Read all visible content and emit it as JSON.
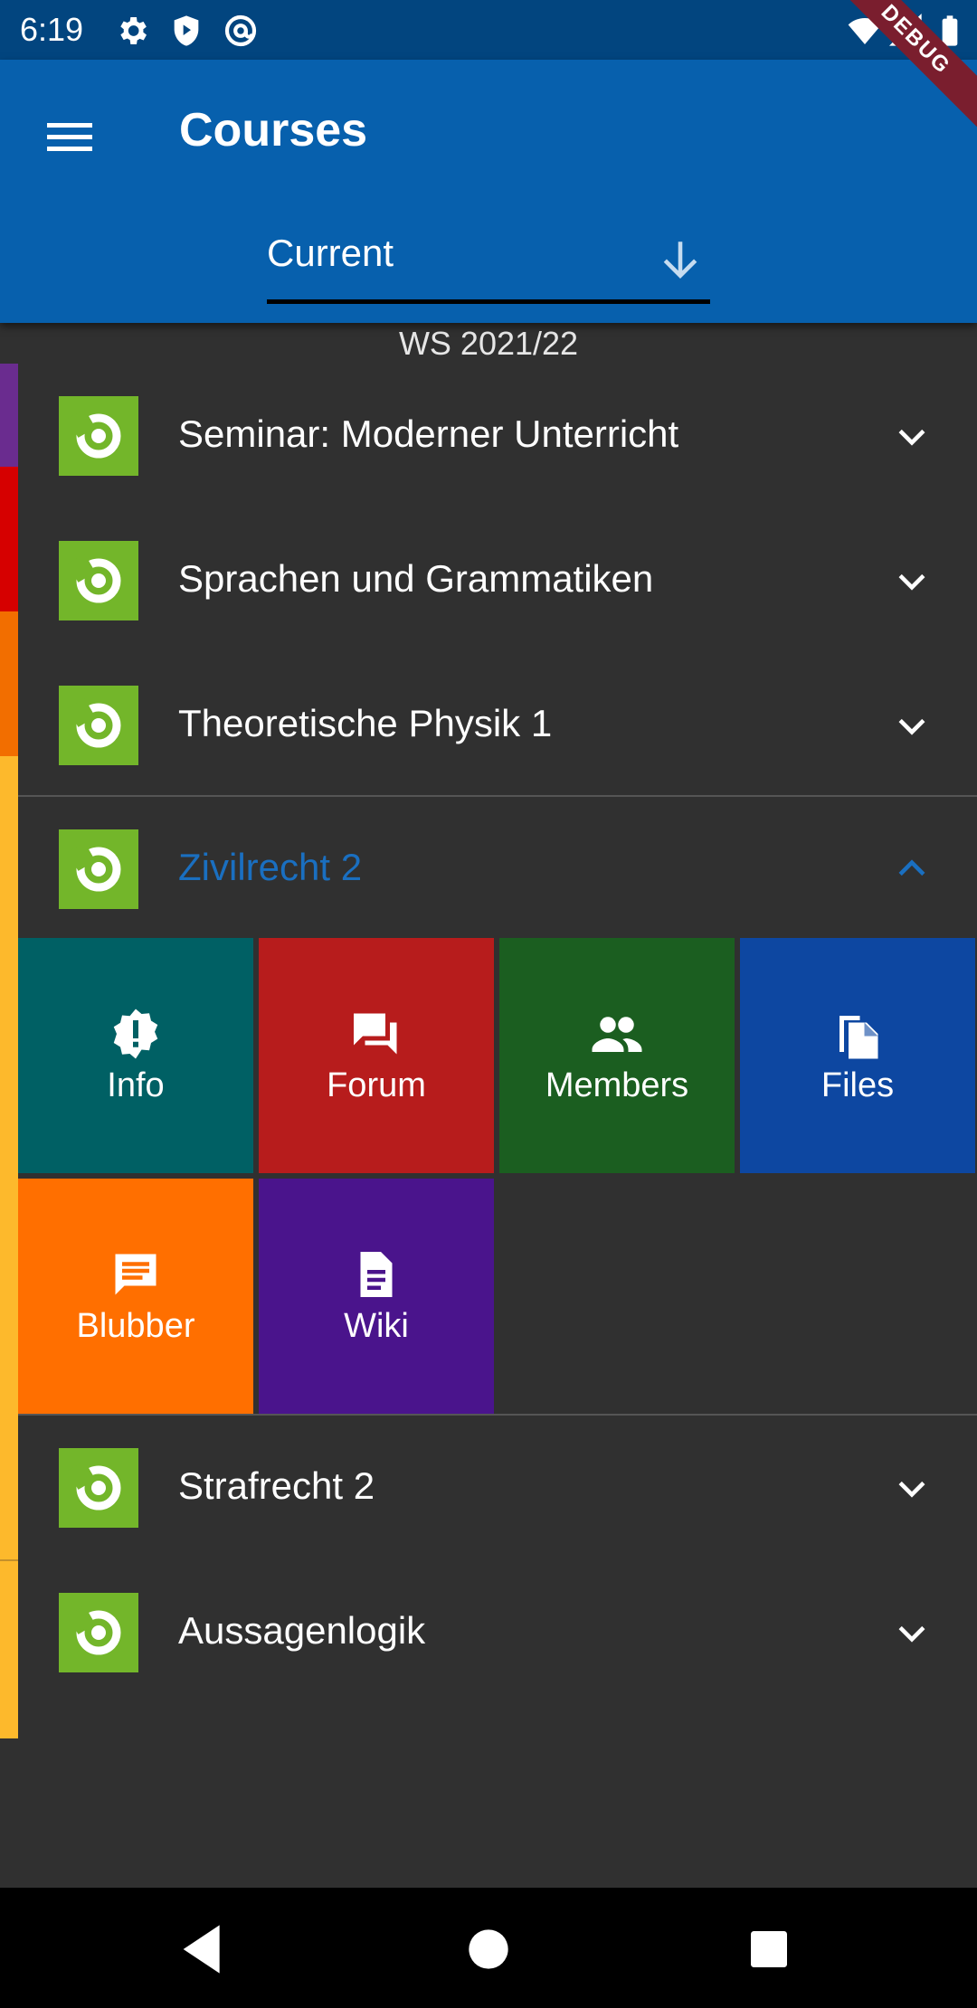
{
  "status_bar": {
    "time": "6:19",
    "debug_label": "DEBUG",
    "icons": [
      "settings-icon",
      "shield-play-icon",
      "at-sign-icon",
      "wifi-icon",
      "signal-icon",
      "battery-icon"
    ]
  },
  "app_bar": {
    "title": "Courses",
    "semester_selected": "Current",
    "color": "#0760ad"
  },
  "semester_group": "WS 2021/22",
  "courses": [
    {
      "name": "Seminar: Moderner Unterricht",
      "color": "#6a2c8f",
      "expanded": false
    },
    {
      "name": "Sprachen und Grammatiken",
      "color": "#d60000",
      "expanded": false
    },
    {
      "name": "Theoretische Physik 1",
      "color": "#f26e00",
      "expanded": false
    },
    {
      "name": "Zivilrecht 2",
      "color": "#fdb92c",
      "expanded": true
    },
    {
      "name": "Strafrecht 2",
      "color": "#fdb92c",
      "expanded": false
    },
    {
      "name": "Aussagenlogik",
      "color": "#fdb92c",
      "expanded": false
    }
  ],
  "tiles": [
    {
      "label": "Info",
      "icon": "info-badge-icon",
      "color": "#006064"
    },
    {
      "label": "Forum",
      "icon": "forum-icon",
      "color": "#b71c1c"
    },
    {
      "label": "Members",
      "icon": "people-icon",
      "color": "#1b5e20"
    },
    {
      "label": "Files",
      "icon": "files-icon",
      "color": "#0d47a1"
    },
    {
      "label": "Blubber",
      "icon": "chat-icon",
      "color": "#ff6f00"
    },
    {
      "label": "Wiki",
      "icon": "document-icon",
      "color": "#4a148c"
    }
  ]
}
